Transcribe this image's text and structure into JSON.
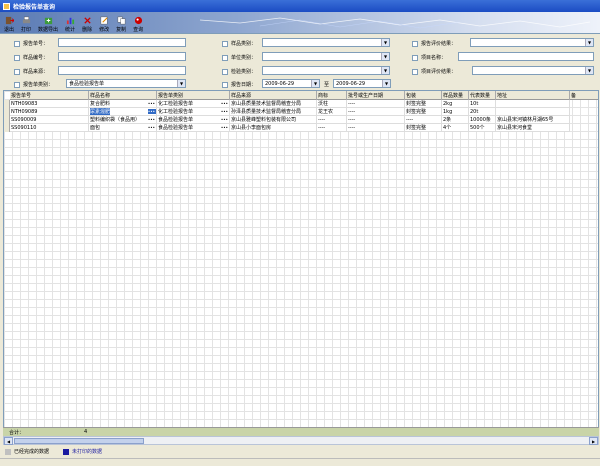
{
  "window": {
    "title": "检验报告单查询"
  },
  "toolbar": {
    "buttons": [
      {
        "label": "退出",
        "icon": "exit-icon"
      },
      {
        "label": "打印",
        "icon": "printer-icon"
      },
      {
        "label": "数据导出",
        "icon": "export-icon"
      },
      {
        "label": "统计",
        "icon": "statistics-icon"
      },
      {
        "label": "删除",
        "icon": "delete-icon"
      },
      {
        "label": "修改",
        "icon": "edit-icon"
      },
      {
        "label": "复制",
        "icon": "copy-icon"
      },
      {
        "label": "查询",
        "icon": "search-icon"
      }
    ]
  },
  "filters": {
    "report_no": "报告单号：",
    "sample_no": "样品编号：",
    "sample_source": "样品来源：",
    "report_type": "报告单类别：",
    "report_type_value": "食品检验报告单",
    "sample_category": "样品类别：",
    "unit_category": "单位类别：",
    "test_category": "检验类别：",
    "report_date": "报告日期：",
    "date_from": "2009-06-29",
    "date_to_label": "至",
    "date_to": "2009-06-29",
    "report_eval": "报告评价结果：",
    "item_name": "项目名称：",
    "item_eval": "项目评价结果："
  },
  "grid": {
    "headers": [
      "报告单号",
      "样品名称",
      "报告单类别",
      "样品来源",
      "商标",
      "批号或生产日期",
      "包装",
      "样品数量",
      "代表数量",
      "地址",
      "备"
    ],
    "rows": [
      [
        "NTH09083",
        "复合肥料",
        "化工检验报告单",
        "京山县质量技术监督局稽查分局",
        "沃柱",
        "----",
        "封签完整",
        "2kg",
        "10t",
        ""
      ],
      [
        "NTH09089",
        "尿素混肥",
        "化工检验报告单",
        "孙泽县质量技术监督局稽查分局",
        "龙王农",
        "----",
        "封签完整",
        "1kg",
        "20t",
        ""
      ],
      [
        "SS090009",
        "塑料编织袋（食品用）",
        "食品检验报告单",
        "京山县雅峰塑料包装有限公司",
        "----",
        "----",
        "----",
        "2条",
        "10000条",
        "京山县宋河镇林月湖65号"
      ],
      [
        "SS090110",
        "面包",
        "食品检验报告单",
        "京山县小李面包房",
        "----",
        "----",
        "封签完整",
        "4个",
        "500个",
        "京山县宋河食堂"
      ]
    ]
  },
  "footer": {
    "total_label": "合计：",
    "total_count": "4"
  },
  "legend": {
    "completed": "已经完成的数据",
    "unprinted": "未打印的数据",
    "completed_color": "#c0c0c0",
    "unprinted_color": "#1a1aa0"
  }
}
